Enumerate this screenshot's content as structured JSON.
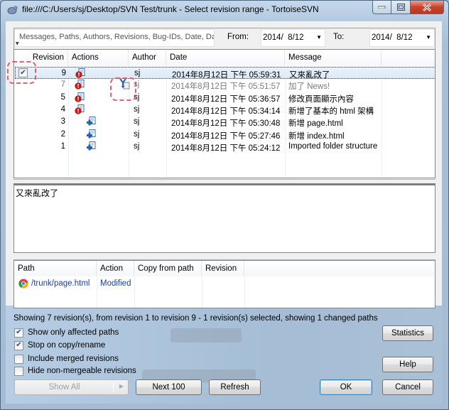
{
  "window": {
    "title": "file:///C:/Users/sj/Desktop/SVN Test/trunk - Select revision range - TortoiseSVN",
    "controls": [
      "minimize",
      "maximize",
      "close"
    ]
  },
  "filter": {
    "search_placeholder": "Messages, Paths, Authors, Revisions, Bug-IDs, Date, Da",
    "from_label": "From:",
    "from_value": "2014/  8/12",
    "to_label": "To:",
    "to_value": "2014/  8/12"
  },
  "revisions": {
    "columns": [
      "Revision",
      "Actions",
      "Author",
      "Date",
      "Message"
    ],
    "rows": [
      {
        "revision": "9",
        "actions": [
          "modified"
        ],
        "author": "sj",
        "date": "2014年8月12日 下午 05:59:31",
        "message": "又來亂改了",
        "checked": true,
        "selected": true
      },
      {
        "revision": "7",
        "actions": [
          "modified",
          "merged"
        ],
        "author": "sj",
        "date": "2014年8月12日 下午 05:51:57",
        "message": "加了 News!",
        "checked": false,
        "selected": false,
        "greyed": true
      },
      {
        "revision": "5",
        "actions": [
          "modified"
        ],
        "author": "sj",
        "date": "2014年8月12日 下午 05:36:57",
        "message": "修改頁面顯示內容",
        "checked": false,
        "selected": false
      },
      {
        "revision": "4",
        "actions": [
          "modified"
        ],
        "author": "sj",
        "date": "2014年8月12日 下午 05:34:14",
        "message": "新增了基本的 html 架構",
        "checked": false,
        "selected": false
      },
      {
        "revision": "3",
        "actions": [
          "added"
        ],
        "author": "sj",
        "date": "2014年8月12日 下午 05:30:48",
        "message": "新增 page.html",
        "checked": false,
        "selected": false
      },
      {
        "revision": "2",
        "actions": [
          "added"
        ],
        "author": "sj",
        "date": "2014年8月12日 下午 05:27:46",
        "message": "新增 index.html",
        "checked": false,
        "selected": false
      },
      {
        "revision": "1",
        "actions": [
          "added"
        ],
        "author": "sj",
        "date": "2014年8月12日 下午 05:24:12",
        "message": "Imported folder structure",
        "checked": false,
        "selected": false
      }
    ]
  },
  "message_text": "又來亂改了",
  "paths": {
    "columns": [
      "Path",
      "Action",
      "Copy from path",
      "Revision"
    ],
    "rows": [
      {
        "path": "/trunk/page.html",
        "action": "Modified",
        "copy_from": "",
        "revision": "",
        "icon": "chrome-file-icon"
      }
    ]
  },
  "status_text": "Showing 7 revision(s), from revision 1 to revision 9 - 1 revision(s) selected, showing 1 changed paths",
  "options": [
    {
      "label": "Show only affected paths",
      "checked": true
    },
    {
      "label": "Stop on copy/rename",
      "checked": true
    },
    {
      "label": "Include merged revisions",
      "checked": false
    },
    {
      "label": "Hide non-mergeable revisions",
      "checked": false
    }
  ],
  "buttons": {
    "show_all": "Show All",
    "next_100": "Next 100",
    "refresh": "Refresh",
    "statistics": "Statistics",
    "help": "Help",
    "ok": "OK",
    "cancel": "Cancel"
  }
}
